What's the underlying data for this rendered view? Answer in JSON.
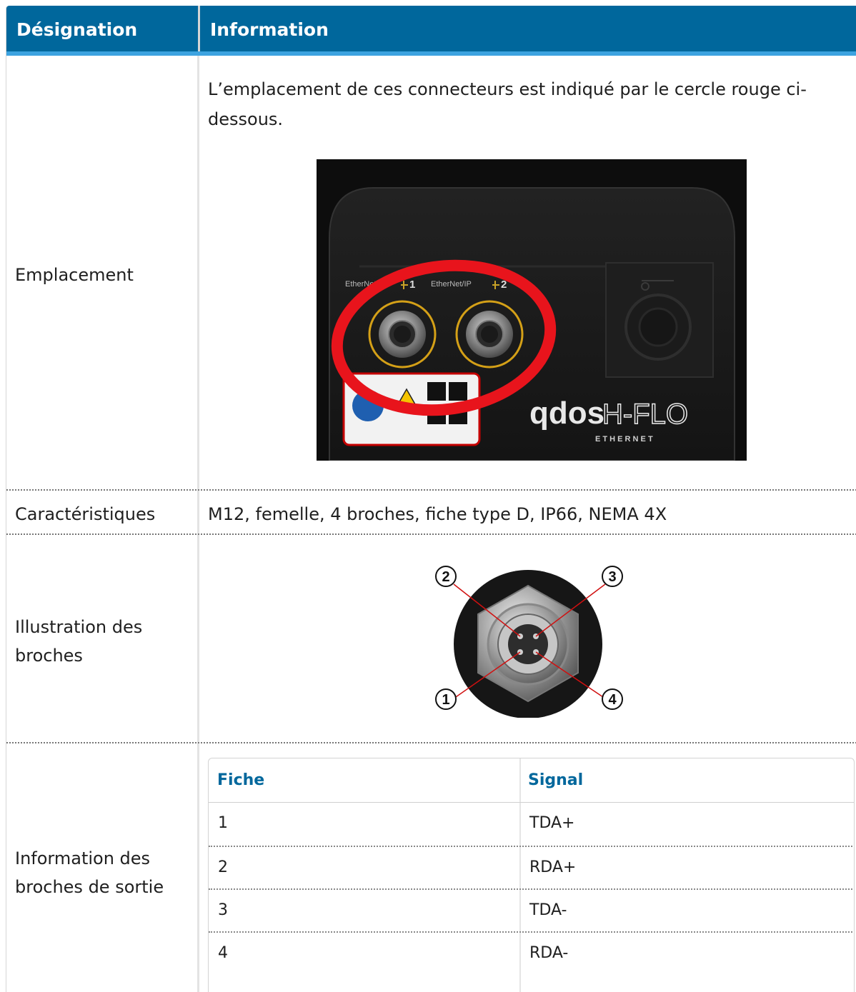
{
  "header": {
    "col1": "Désignation",
    "col2": "Information"
  },
  "rows": {
    "emplacement": {
      "label": "Emplacement",
      "text_line1": "L’emplacement de ces connecteurs est indiqué par le cercle rouge ci-",
      "text_line2": "dessous.",
      "photo": {
        "port1_label": "EtherNet/IP",
        "port1_num": "1",
        "port2_label": "EtherNet/IP",
        "port2_num": "2",
        "brand": "qdos",
        "model": "H-FLO",
        "sub": "E T H E R N E T"
      }
    },
    "caracteristiques": {
      "label": "Caractéristiques",
      "text": "M12, femelle, 4 broches, fiche type D, IP66, NEMA 4X"
    },
    "illustration": {
      "label_line1": "Illustration des",
      "label_line2": "broches",
      "pins": [
        "1",
        "2",
        "3",
        "4"
      ]
    },
    "information": {
      "label_line1": "Information des",
      "label_line2": "broches de sortie",
      "table": {
        "headers": [
          "Fiche",
          "Signal"
        ],
        "rows": [
          [
            "1",
            "TDA+"
          ],
          [
            "2",
            "RDA+"
          ],
          [
            "3",
            "TDA-"
          ],
          [
            "4",
            "RDA-"
          ]
        ]
      }
    }
  },
  "colors": {
    "header_bg": "#00679c",
    "header_accent": "#3da3e0",
    "inner_header_text": "#00679c",
    "highlight_circle": "#e8141c",
    "port_ring": "#d4a017"
  }
}
